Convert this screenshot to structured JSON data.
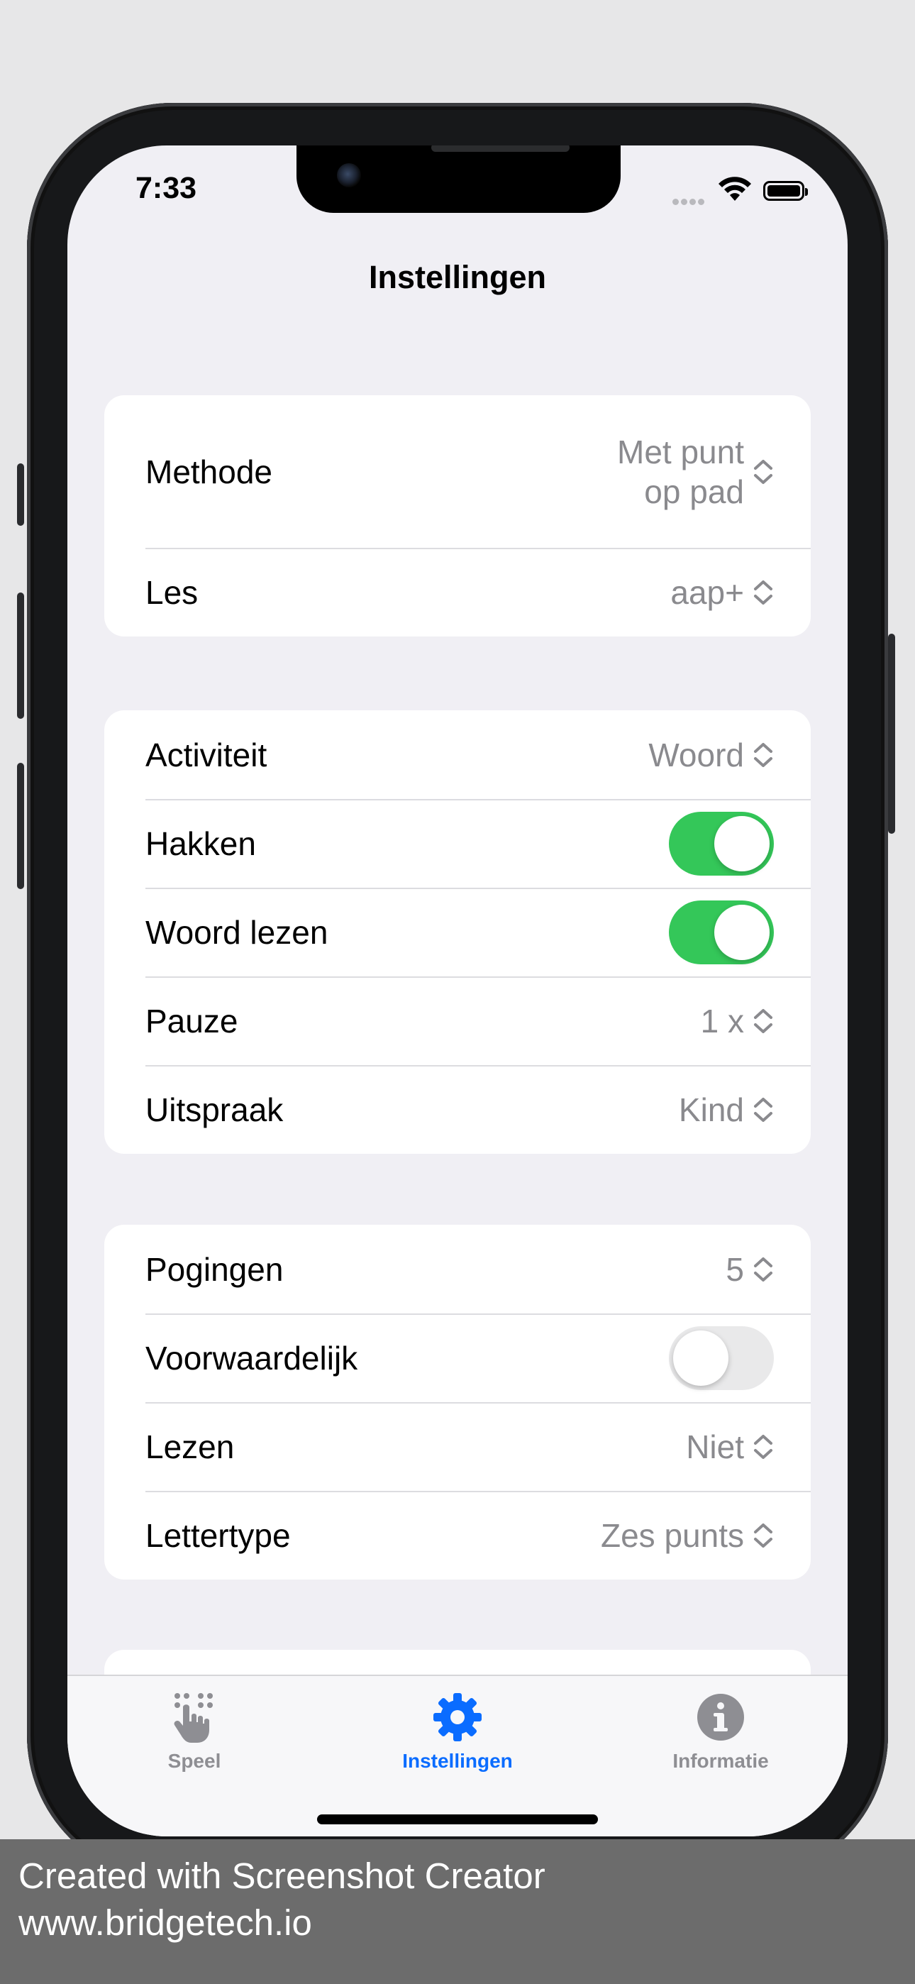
{
  "status_bar": {
    "time": "7:33"
  },
  "navigation": {
    "title": "Instellingen"
  },
  "section1": [
    {
      "label": "Methode",
      "value_line1": "Met punt",
      "value_line2": "op pad"
    },
    {
      "label": "Les",
      "value": "aap+"
    }
  ],
  "section2": [
    {
      "label": "Activiteit",
      "value": "Woord"
    },
    {
      "label": "Hakken",
      "toggle": true
    },
    {
      "label": "Woord lezen",
      "toggle": true
    },
    {
      "label": "Pauze",
      "value": "1 x"
    },
    {
      "label": "Uitspraak",
      "value": "Kind"
    }
  ],
  "section3": [
    {
      "label": "Pogingen",
      "value": "5"
    },
    {
      "label": "Voorwaardelijk",
      "toggle": false
    },
    {
      "label": "Lezen",
      "value": "Niet"
    },
    {
      "label": "Lettertype",
      "value": "Zes punts"
    }
  ],
  "tab_bar": {
    "tabs": [
      {
        "label": "Speel",
        "icon": "hand-dots-icon",
        "active": false
      },
      {
        "label": "Instellingen",
        "icon": "gear-icon",
        "active": true
      },
      {
        "label": "Informatie",
        "icon": "info-icon",
        "active": false
      }
    ]
  },
  "footer": {
    "line1": "Created with Screenshot Creator",
    "line2": "www.bridgetech.io"
  },
  "colors": {
    "accent": "#0a6cff",
    "toggle_on": "#34c759",
    "background": "#f0eff4"
  }
}
